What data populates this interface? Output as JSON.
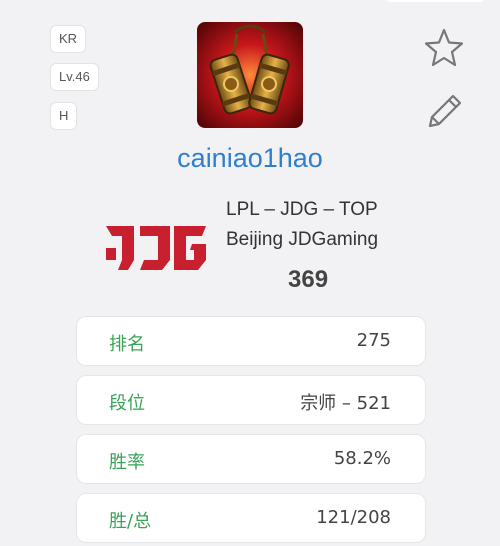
{
  "profile": {
    "region_badge": "KR",
    "level_badge": "Lv.46",
    "extra_badge": "H",
    "username": "cainiao1hao",
    "team_line": "LPL – JDG – TOP",
    "team_name": "Beijing JDGaming",
    "score": "369"
  },
  "actions": {
    "star_icon": "star-outline",
    "edit_icon": "pencil"
  },
  "stats": [
    {
      "label": "排名",
      "value": "275"
    },
    {
      "label": "段位",
      "value": "宗师 – 521"
    },
    {
      "label": "胜率",
      "value": "58.2%"
    },
    {
      "label": "胜/总",
      "value": "121/208"
    }
  ],
  "colors": {
    "accent_blue": "#2f7fd0",
    "label_green": "#3aa35a",
    "logo_red": "#c8202e"
  }
}
